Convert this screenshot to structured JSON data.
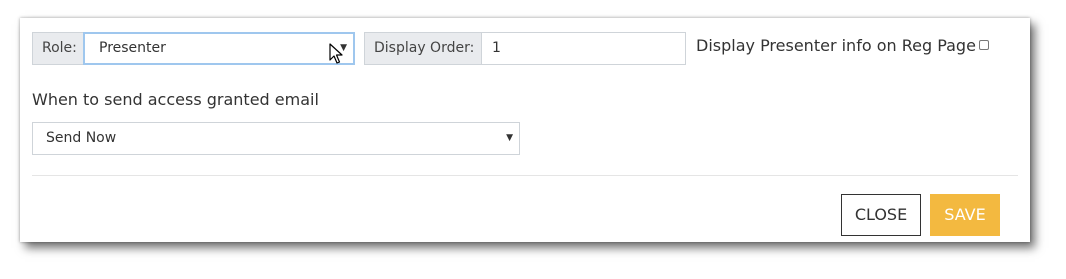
{
  "role": {
    "label": "Role:",
    "value": "Presenter"
  },
  "display_order": {
    "label": "Display Order:",
    "value": "1"
  },
  "display_presenter": {
    "label": "Display Presenter info on Reg Page",
    "checked": false
  },
  "access_email": {
    "label": "When to send access granted email",
    "value": "Send Now"
  },
  "buttons": {
    "close": "CLOSE",
    "save": "SAVE"
  },
  "colors": {
    "save_bg": "#f3b940",
    "focus_border": "#9fc7ee",
    "addon_bg": "#e9ebee"
  },
  "icons": {
    "dropdown": "caret-down-icon",
    "cursor": "mouse-pointer-icon"
  }
}
